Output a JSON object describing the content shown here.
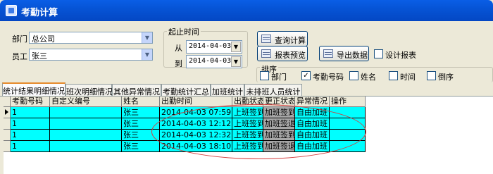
{
  "window": {
    "title": "考勤计算"
  },
  "filters": {
    "dept_label": "部门",
    "dept_value": "总公司",
    "emp_label": "员工",
    "emp_value": "张三"
  },
  "period": {
    "group_title": "起止时间",
    "from_label": "从",
    "from_value": "2014-04-03",
    "to_label": "到",
    "to_value": "2014-04-03"
  },
  "actions": {
    "query": "查询计算",
    "preview": "报表预览",
    "export": "导出数据",
    "design": "设计报表"
  },
  "sort": {
    "title": "排序",
    "options": [
      {
        "label": "部门",
        "checked": false
      },
      {
        "label": "考勤号码",
        "checked": true
      },
      {
        "label": "姓名",
        "checked": false
      },
      {
        "label": "时间",
        "checked": false
      },
      {
        "label": "倒序",
        "checked": false
      }
    ]
  },
  "tabs": [
    "统计结果明细情况",
    "班次明细情况",
    "其他异常情况",
    "考勤统计汇总",
    "加班统计",
    "未排班人员统计"
  ],
  "table": {
    "columns": [
      "考勤号码",
      "自定义编号",
      "姓名",
      "出勤时间",
      "出勤状态",
      "更正状态",
      "异常情况",
      "操作"
    ],
    "rows": [
      [
        "1",
        "",
        "张三",
        "2014-04-03 07:59",
        "上班签到",
        "加班签到",
        "自由加班",
        ""
      ],
      [
        "1",
        "",
        "张三",
        "2014-04-03 12:12",
        "上班签到",
        "加班签退",
        "自由加班",
        ""
      ],
      [
        "1",
        "",
        "张三",
        "2014-04-03 12:32",
        "上班签到",
        "加班签到",
        "自由加班",
        ""
      ],
      [
        "1",
        "",
        "张三",
        "2014-04-03 18:10",
        "上班签到",
        "加班签退",
        "自由加班",
        ""
      ]
    ]
  },
  "colors": {
    "row_bg": "#00ffff",
    "correct_bg": "#a7a7a7",
    "annotation": "#d43c3c"
  }
}
